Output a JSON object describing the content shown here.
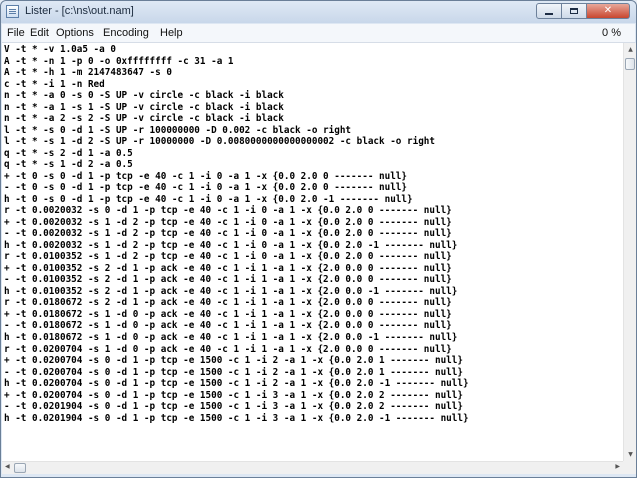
{
  "window": {
    "title": "Lister - [c:\\ns\\out.nam]",
    "min_label": "",
    "max_label": "",
    "close_label": "✕"
  },
  "menu": {
    "items": [
      "File",
      "Edit",
      "Options",
      "Encoding",
      "Help"
    ],
    "progress": "0 %"
  },
  "lines": [
    "V -t * -v 1.0a5 -a 0",
    "A -t * -n 1 -p 0 -o 0xffffffff -c 31 -a 1",
    "A -t * -h 1 -m 2147483647 -s 0",
    "c -t * -i 1 -n Red",
    "n -t * -a 0 -s 0 -S UP -v circle -c black -i black",
    "n -t * -a 1 -s 1 -S UP -v circle -c black -i black",
    "n -t * -a 2 -s 2 -S UP -v circle -c black -i black",
    "l -t * -s 0 -d 1 -S UP -r 100000000 -D 0.002 -c black -o right",
    "l -t * -s 1 -d 2 -S UP -r 10000000 -D 0.0080000000000000002 -c black -o right",
    "q -t * -s 2 -d 1 -a 0.5",
    "q -t * -s 1 -d 2 -a 0.5",
    "+ -t 0 -s 0 -d 1 -p tcp -e 40 -c 1 -i 0 -a 1 -x {0.0 2.0 0 ------- null}",
    "- -t 0 -s 0 -d 1 -p tcp -e 40 -c 1 -i 0 -a 1 -x {0.0 2.0 0 ------- null}",
    "h -t 0 -s 0 -d 1 -p tcp -e 40 -c 1 -i 0 -a 1 -x {0.0 2.0 -1 ------- null}",
    "r -t 0.0020032 -s 0 -d 1 -p tcp -e 40 -c 1 -i 0 -a 1 -x {0.0 2.0 0 ------- null}",
    "+ -t 0.0020032 -s 1 -d 2 -p tcp -e 40 -c 1 -i 0 -a 1 -x {0.0 2.0 0 ------- null}",
    "- -t 0.0020032 -s 1 -d 2 -p tcp -e 40 -c 1 -i 0 -a 1 -x {0.0 2.0 0 ------- null}",
    "h -t 0.0020032 -s 1 -d 2 -p tcp -e 40 -c 1 -i 0 -a 1 -x {0.0 2.0 -1 ------- null}",
    "r -t 0.0100352 -s 1 -d 2 -p tcp -e 40 -c 1 -i 0 -a 1 -x {0.0 2.0 0 ------- null}",
    "+ -t 0.0100352 -s 2 -d 1 -p ack -e 40 -c 1 -i 1 -a 1 -x {2.0 0.0 0 ------- null}",
    "- -t 0.0100352 -s 2 -d 1 -p ack -e 40 -c 1 -i 1 -a 1 -x {2.0 0.0 0 ------- null}",
    "h -t 0.0100352 -s 2 -d 1 -p ack -e 40 -c 1 -i 1 -a 1 -x {2.0 0.0 -1 ------- null}",
    "r -t 0.0180672 -s 2 -d 1 -p ack -e 40 -c 1 -i 1 -a 1 -x {2.0 0.0 0 ------- null}",
    "+ -t 0.0180672 -s 1 -d 0 -p ack -e 40 -c 1 -i 1 -a 1 -x {2.0 0.0 0 ------- null}",
    "- -t 0.0180672 -s 1 -d 0 -p ack -e 40 -c 1 -i 1 -a 1 -x {2.0 0.0 0 ------- null}",
    "h -t 0.0180672 -s 1 -d 0 -p ack -e 40 -c 1 -i 1 -a 1 -x {2.0 0.0 -1 ------- null}",
    "r -t 0.0200704 -s 1 -d 0 -p ack -e 40 -c 1 -i 1 -a 1 -x {2.0 0.0 0 ------- null}",
    "+ -t 0.0200704 -s 0 -d 1 -p tcp -e 1500 -c 1 -i 2 -a 1 -x {0.0 2.0 1 ------- null}",
    "- -t 0.0200704 -s 0 -d 1 -p tcp -e 1500 -c 1 -i 2 -a 1 -x {0.0 2.0 1 ------- null}",
    "h -t 0.0200704 -s 0 -d 1 -p tcp -e 1500 -c 1 -i 2 -a 1 -x {0.0 2.0 -1 ------- null}",
    "+ -t 0.0200704 -s 0 -d 1 -p tcp -e 1500 -c 1 -i 3 -a 1 -x {0.0 2.0 2 ------- null}",
    "- -t 0.0201904 -s 0 -d 1 -p tcp -e 1500 -c 1 -i 3 -a 1 -x {0.0 2.0 2 ------- null}",
    "h -t 0.0201904 -s 0 -d 1 -p tcp -e 1500 -c 1 -i 3 -a 1 -x {0.0 2.0 -1 ------- null}"
  ],
  "scrollbars": {
    "vertical_position": 0,
    "horizontal_position": 0
  }
}
